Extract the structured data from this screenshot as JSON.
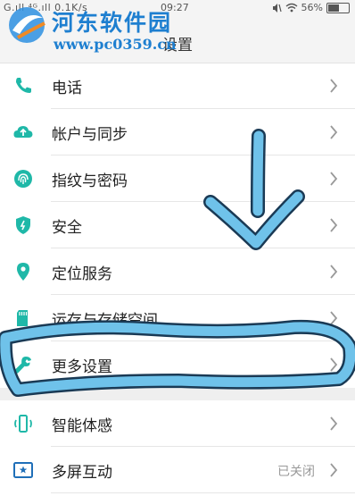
{
  "status_bar": {
    "left": "G.ıll ⁴ᴳ.ıll 0.1K/s",
    "time": "09:27",
    "battery": "56%",
    "battery_level": 0.56
  },
  "header": {
    "title": "设置"
  },
  "watermark": {
    "name": "河东软件园",
    "url": "www.pc0359.cn"
  },
  "settings": [
    {
      "label": "电话",
      "icon": "phone-icon",
      "value": ""
    },
    {
      "label": "帐户与同步",
      "icon": "cloud-sync-icon",
      "value": ""
    },
    {
      "label": "指纹与密码",
      "icon": "fingerprint-icon",
      "value": ""
    },
    {
      "label": "安全",
      "icon": "shield-icon",
      "value": ""
    },
    {
      "label": "定位服务",
      "icon": "location-pin-icon",
      "value": ""
    },
    {
      "label": "运存与存储空间",
      "icon": "storage-card-icon",
      "value": ""
    },
    {
      "label": "更多设置",
      "icon": "wrench-icon",
      "value": ""
    },
    {
      "label": "智能体感",
      "icon": "phone-motion-icon",
      "value": ""
    },
    {
      "label": "多屏互动",
      "icon": "multi-screen-icon",
      "value": "已关闭"
    }
  ],
  "colors": {
    "icon_accent": "#1fb8a8",
    "annotation_stroke": "#6fc2ea",
    "watermark": "#1e7fd0"
  }
}
